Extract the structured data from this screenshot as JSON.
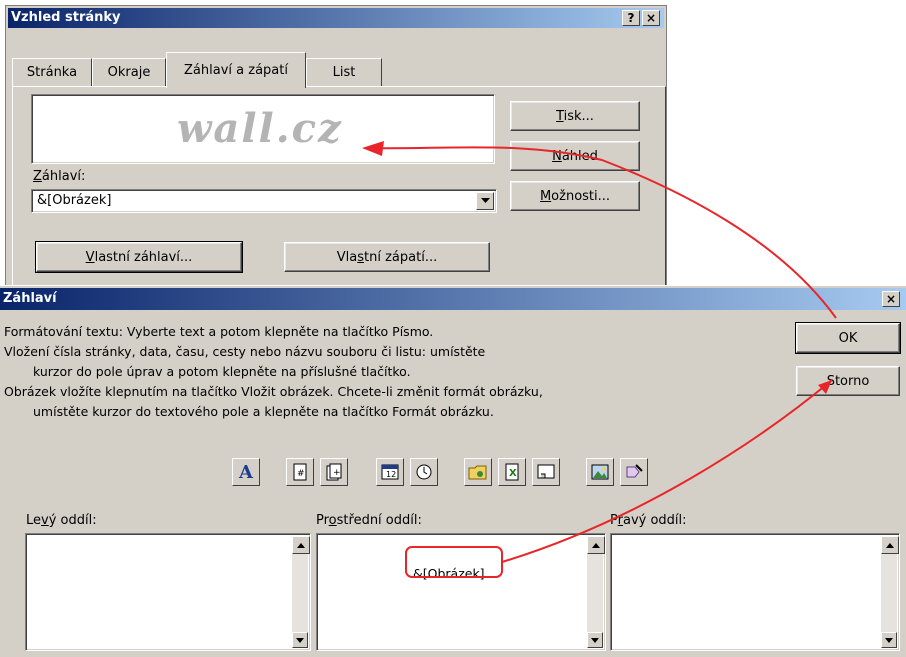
{
  "page_setup": {
    "title": "Vzhled stránky",
    "help_btn": "?",
    "close_btn": "×",
    "tabs": [
      {
        "label": "Stránka"
      },
      {
        "label": "Okraje"
      },
      {
        "label": "Záhlaví a zápatí"
      },
      {
        "label": "List"
      }
    ],
    "preview_text": "wall.cz",
    "header_label_u": "Z",
    "header_label_rest": "áhlaví:",
    "header_value": "&[Obrázek]",
    "custom_header_u": "V",
    "custom_header_rest": "lastní záhlaví...",
    "custom_footer_a": "Vla",
    "custom_footer_u": "s",
    "custom_footer_b": "tní zápatí...",
    "print_u": "T",
    "print_rest": "isk...",
    "preview_u": "N",
    "preview_rest": "áhled",
    "options_u": "M",
    "options_rest": "ožnosti..."
  },
  "header_dialog": {
    "title": "Záhlaví",
    "close_btn": "×",
    "instructions": [
      "Formátování textu: Vyberte text a potom klepněte na tlačítko Písmo.",
      "Vložení čísla stránky, data, času, cesty nebo názvu souboru či listu: umístěte",
      "kurzor do pole úprav a potom klepněte na příslušné tlačítko.",
      "Obrázek vložíte klepnutím na tlačítko Vložit obrázek. Chcete-li změnit formát obrázku,",
      "umístěte kurzor do textového pole a klepněte na tlačítko Formát obrázku."
    ],
    "ok": "OK",
    "cancel": "Storno",
    "toolbar_font_glyph": "A",
    "left_section_a": "Le",
    "left_section_u": "v",
    "left_section_b": "ý oddíl:",
    "center_section_a": "Pr",
    "center_section_u": "o",
    "center_section_b": "střední oddíl:",
    "right_section_a": "P",
    "right_section_u": "r",
    "right_section_b": "avý oddíl:",
    "center_value": "&[Obrázek]",
    "left_value": "",
    "right_value": ""
  },
  "colors": {
    "title_start": "#0a246a",
    "title_end": "#a6caf0",
    "dialog_face": "#d4d0c8",
    "annotation": "#e8262a"
  }
}
